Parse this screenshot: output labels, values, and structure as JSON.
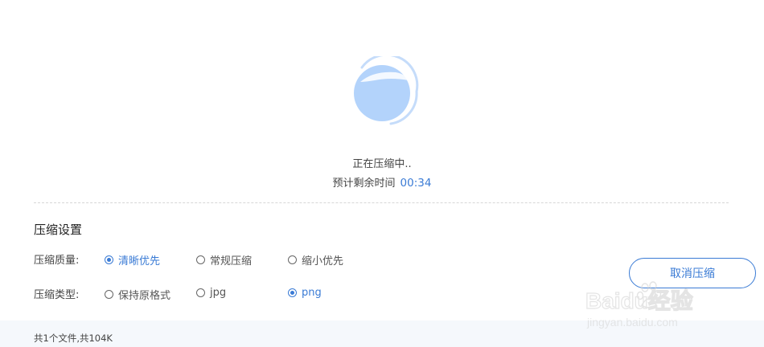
{
  "progress": {
    "status_text": "正在压缩中..",
    "eta_label": "预计剩余时间",
    "eta_value": "00:34"
  },
  "settings": {
    "title": "压缩设置",
    "quality": {
      "label": "压缩质量:",
      "options": [
        {
          "label": "清晰优先",
          "selected": true
        },
        {
          "label": "常规压缩",
          "selected": false
        },
        {
          "label": "缩小优先",
          "selected": false
        }
      ]
    },
    "type": {
      "label": "压缩类型:",
      "options": [
        {
          "label": "保持原格式",
          "selected": false
        },
        {
          "label": "jpg",
          "selected": false
        },
        {
          "label": "png",
          "selected": true
        }
      ]
    }
  },
  "actions": {
    "cancel_label": "取消压缩"
  },
  "footer": {
    "summary": "共1个文件,共104K"
  },
  "watermark": {
    "brand": "Baidu经验",
    "url": "jingyan.baidu.com"
  },
  "colors": {
    "accent": "#3a7bd5",
    "spinner_fill": "#b3d3fb",
    "footer_bg": "#f5f8fc"
  }
}
